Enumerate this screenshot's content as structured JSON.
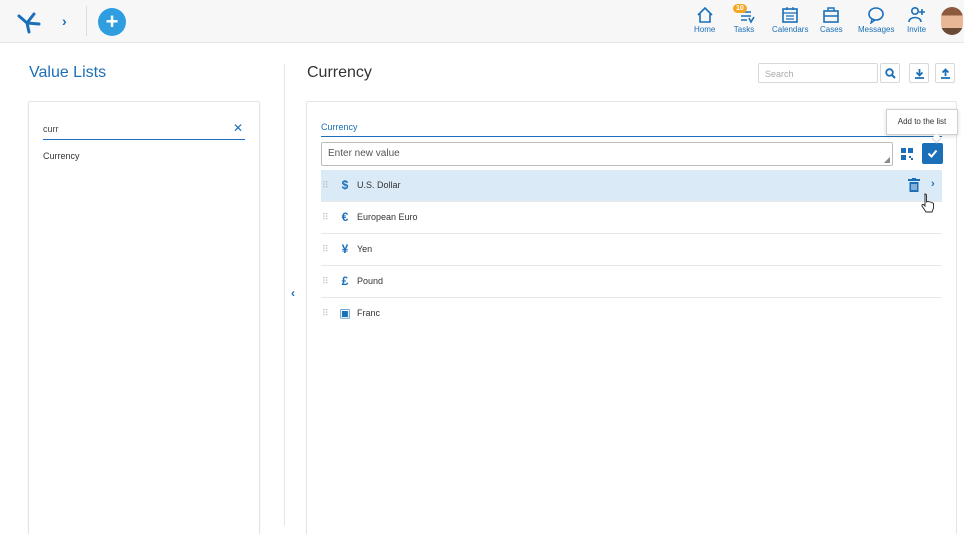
{
  "header": {
    "nav": [
      {
        "label": "Home",
        "icon": "home-icon"
      },
      {
        "label": "Tasks",
        "icon": "tasks-icon",
        "badge": "10"
      },
      {
        "label": "Calendars",
        "icon": "calendar-icon"
      },
      {
        "label": "Cases",
        "icon": "briefcase-icon"
      },
      {
        "label": "Messages",
        "icon": "message-icon"
      },
      {
        "label": "Invite",
        "icon": "invite-user-icon"
      }
    ],
    "add_label": "+"
  },
  "left": {
    "title": "Value Lists",
    "search_value": "curr",
    "results": [
      "Currency"
    ]
  },
  "right": {
    "title": "Currency",
    "search_placeholder": "Search",
    "list_label": "Currency",
    "tooltip": "Add to the list",
    "new_value_placeholder": "Enter new value",
    "items": [
      {
        "label": "U.S. Dollar",
        "icon": "dollar-hand-icon",
        "glyph": "$"
      },
      {
        "label": "European Euro",
        "icon": "euro-icon",
        "glyph": "€"
      },
      {
        "label": "Yen",
        "icon": "yen-icon",
        "glyph": "¥"
      },
      {
        "label": "Pound",
        "icon": "pound-icon",
        "glyph": "£"
      },
      {
        "label": "Franc",
        "icon": "banknote-icon",
        "glyph": "▣"
      }
    ]
  },
  "colors": {
    "accent": "#1b6fb8",
    "selected_row": "#daeaf6",
    "badge": "#f5a623"
  }
}
